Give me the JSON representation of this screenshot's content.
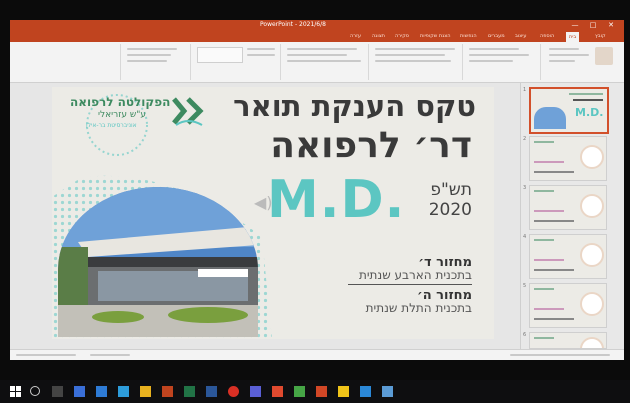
{
  "window": {
    "title": "PowerPoint - 2021/6/8",
    "minimize_glyph": "—",
    "maximize_glyph": "□",
    "close_glyph": "✕"
  },
  "ribbon": {
    "tabs": [
      "קובץ",
      "בית",
      "הוספה",
      "עיצוב",
      "מעברים",
      "הנפשות",
      "הצגת שקופיות",
      "סקירה",
      "תצוגה",
      "עזרה"
    ],
    "active_tab": "בית"
  },
  "slide": {
    "main_title": "טקס הענקת תואר",
    "sub_title": "דר׳ לרפואה",
    "md": "M.D.",
    "year_hebrew": "תש\"פ",
    "year": "2020",
    "cohort1_title": "מחזור ד׳",
    "cohort1_desc": "בתכנית הארבע שנתית",
    "cohort2_title": "מחזור ה׳",
    "cohort2_desc": "בתכנית התלת שנתית",
    "logo_line1": "הפקולטה לרפואה",
    "logo_line2": "ע\"ש עזריאלי",
    "logo_line3": "אוניברסיטת בר-אילן"
  },
  "thumbnails": {
    "slide_numbers": [
      "1",
      "2",
      "3",
      "4",
      "5",
      "6"
    ],
    "selected_index": 0
  },
  "colors": {
    "accent": "#c0441f",
    "teal": "#5cc6c2",
    "green": "#3d8a60",
    "slide_bg": "#ecebe6"
  }
}
